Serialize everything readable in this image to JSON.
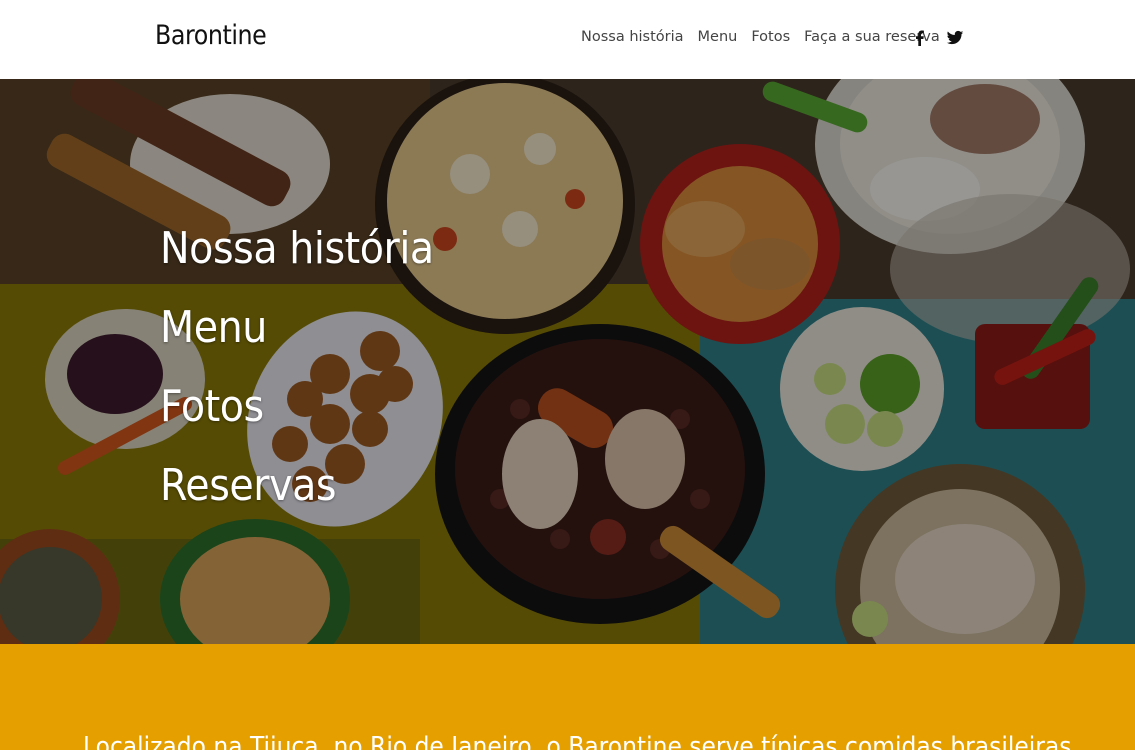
{
  "header": {
    "logo": "Barontine",
    "nav": [
      {
        "label": "Nossa história"
      },
      {
        "label": "Menu"
      },
      {
        "label": "Fotos"
      },
      {
        "label": "Faça a sua reserva"
      }
    ],
    "social": [
      "facebook-icon",
      "twitter-icon"
    ]
  },
  "hero": {
    "links": [
      {
        "label": "Nossa história"
      },
      {
        "label": "Menu"
      },
      {
        "label": "Fotos"
      },
      {
        "label": "Reservas"
      }
    ]
  },
  "intro": {
    "text": "Localizado na Tijuca, no Rio de Janeiro, o Barontine serve típicas comidas brasileiras"
  },
  "colors": {
    "accent": "#e5a000",
    "header_bg": "#ffffff",
    "hero_text": "#ffffff"
  }
}
